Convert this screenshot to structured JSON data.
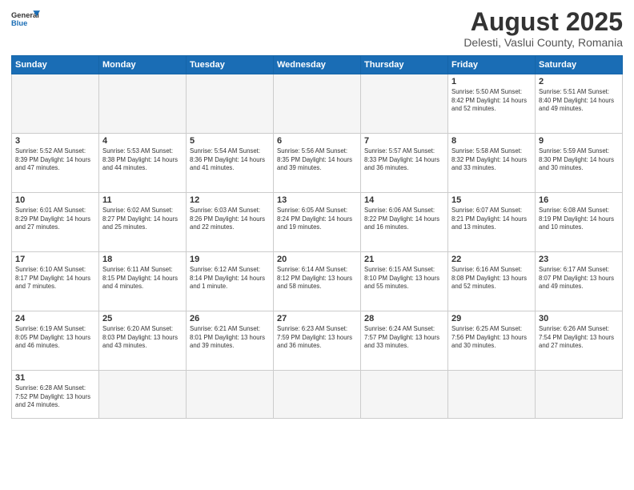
{
  "logo": {
    "text_general": "General",
    "text_blue": "Blue"
  },
  "title": "August 2025",
  "subtitle": "Delesti, Vaslui County, Romania",
  "weekdays": [
    "Sunday",
    "Monday",
    "Tuesday",
    "Wednesday",
    "Thursday",
    "Friday",
    "Saturday"
  ],
  "weeks": [
    [
      {
        "day": "",
        "info": ""
      },
      {
        "day": "",
        "info": ""
      },
      {
        "day": "",
        "info": ""
      },
      {
        "day": "",
        "info": ""
      },
      {
        "day": "",
        "info": ""
      },
      {
        "day": "1",
        "info": "Sunrise: 5:50 AM\nSunset: 8:42 PM\nDaylight: 14 hours and 52 minutes."
      },
      {
        "day": "2",
        "info": "Sunrise: 5:51 AM\nSunset: 8:40 PM\nDaylight: 14 hours and 49 minutes."
      }
    ],
    [
      {
        "day": "3",
        "info": "Sunrise: 5:52 AM\nSunset: 8:39 PM\nDaylight: 14 hours and 47 minutes."
      },
      {
        "day": "4",
        "info": "Sunrise: 5:53 AM\nSunset: 8:38 PM\nDaylight: 14 hours and 44 minutes."
      },
      {
        "day": "5",
        "info": "Sunrise: 5:54 AM\nSunset: 8:36 PM\nDaylight: 14 hours and 41 minutes."
      },
      {
        "day": "6",
        "info": "Sunrise: 5:56 AM\nSunset: 8:35 PM\nDaylight: 14 hours and 39 minutes."
      },
      {
        "day": "7",
        "info": "Sunrise: 5:57 AM\nSunset: 8:33 PM\nDaylight: 14 hours and 36 minutes."
      },
      {
        "day": "8",
        "info": "Sunrise: 5:58 AM\nSunset: 8:32 PM\nDaylight: 14 hours and 33 minutes."
      },
      {
        "day": "9",
        "info": "Sunrise: 5:59 AM\nSunset: 8:30 PM\nDaylight: 14 hours and 30 minutes."
      }
    ],
    [
      {
        "day": "10",
        "info": "Sunrise: 6:01 AM\nSunset: 8:29 PM\nDaylight: 14 hours and 27 minutes."
      },
      {
        "day": "11",
        "info": "Sunrise: 6:02 AM\nSunset: 8:27 PM\nDaylight: 14 hours and 25 minutes."
      },
      {
        "day": "12",
        "info": "Sunrise: 6:03 AM\nSunset: 8:26 PM\nDaylight: 14 hours and 22 minutes."
      },
      {
        "day": "13",
        "info": "Sunrise: 6:05 AM\nSunset: 8:24 PM\nDaylight: 14 hours and 19 minutes."
      },
      {
        "day": "14",
        "info": "Sunrise: 6:06 AM\nSunset: 8:22 PM\nDaylight: 14 hours and 16 minutes."
      },
      {
        "day": "15",
        "info": "Sunrise: 6:07 AM\nSunset: 8:21 PM\nDaylight: 14 hours and 13 minutes."
      },
      {
        "day": "16",
        "info": "Sunrise: 6:08 AM\nSunset: 8:19 PM\nDaylight: 14 hours and 10 minutes."
      }
    ],
    [
      {
        "day": "17",
        "info": "Sunrise: 6:10 AM\nSunset: 8:17 PM\nDaylight: 14 hours and 7 minutes."
      },
      {
        "day": "18",
        "info": "Sunrise: 6:11 AM\nSunset: 8:15 PM\nDaylight: 14 hours and 4 minutes."
      },
      {
        "day": "19",
        "info": "Sunrise: 6:12 AM\nSunset: 8:14 PM\nDaylight: 14 hours and 1 minute."
      },
      {
        "day": "20",
        "info": "Sunrise: 6:14 AM\nSunset: 8:12 PM\nDaylight: 13 hours and 58 minutes."
      },
      {
        "day": "21",
        "info": "Sunrise: 6:15 AM\nSunset: 8:10 PM\nDaylight: 13 hours and 55 minutes."
      },
      {
        "day": "22",
        "info": "Sunrise: 6:16 AM\nSunset: 8:08 PM\nDaylight: 13 hours and 52 minutes."
      },
      {
        "day": "23",
        "info": "Sunrise: 6:17 AM\nSunset: 8:07 PM\nDaylight: 13 hours and 49 minutes."
      }
    ],
    [
      {
        "day": "24",
        "info": "Sunrise: 6:19 AM\nSunset: 8:05 PM\nDaylight: 13 hours and 46 minutes."
      },
      {
        "day": "25",
        "info": "Sunrise: 6:20 AM\nSunset: 8:03 PM\nDaylight: 13 hours and 43 minutes."
      },
      {
        "day": "26",
        "info": "Sunrise: 6:21 AM\nSunset: 8:01 PM\nDaylight: 13 hours and 39 minutes."
      },
      {
        "day": "27",
        "info": "Sunrise: 6:23 AM\nSunset: 7:59 PM\nDaylight: 13 hours and 36 minutes."
      },
      {
        "day": "28",
        "info": "Sunrise: 6:24 AM\nSunset: 7:57 PM\nDaylight: 13 hours and 33 minutes."
      },
      {
        "day": "29",
        "info": "Sunrise: 6:25 AM\nSunset: 7:56 PM\nDaylight: 13 hours and 30 minutes."
      },
      {
        "day": "30",
        "info": "Sunrise: 6:26 AM\nSunset: 7:54 PM\nDaylight: 13 hours and 27 minutes."
      }
    ],
    [
      {
        "day": "31",
        "info": "Sunrise: 6:28 AM\nSunset: 7:52 PM\nDaylight: 13 hours and 24 minutes."
      },
      {
        "day": "",
        "info": ""
      },
      {
        "day": "",
        "info": ""
      },
      {
        "day": "",
        "info": ""
      },
      {
        "day": "",
        "info": ""
      },
      {
        "day": "",
        "info": ""
      },
      {
        "day": "",
        "info": ""
      }
    ]
  ]
}
